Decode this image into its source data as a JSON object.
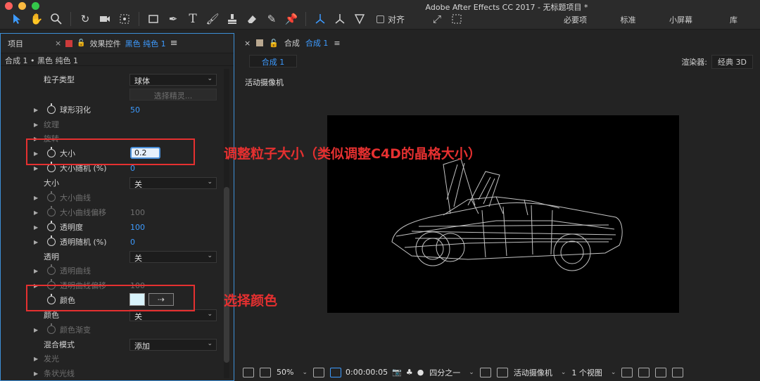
{
  "window": {
    "title": "Adobe After Effects CC 2017 - 无标题项目 *"
  },
  "toolbar": {
    "snap_label": "对齐"
  },
  "workspaces": [
    "必要项",
    "标准",
    "小屏幕",
    "库"
  ],
  "left_panel": {
    "tab_project": "项目",
    "tab_effects": "效果控件",
    "tab_effects_layer": "黑色 纯色 1",
    "breadcrumb": "合成 1 • 黑色 纯色 1",
    "rows": {
      "particle_type_label": "粒子类型",
      "particle_type_value": "球体",
      "choose_sprite": "选择精灵...",
      "sphere_feather_label": "球形羽化",
      "sphere_feather_value": "50",
      "texture_label": "纹理",
      "rotation_label": "旋转",
      "size_label": "大小",
      "size_value": "0.2",
      "size_random_label": "大小随机 (%)",
      "size_random_value": "0",
      "size_over_life_label": "大小",
      "size_over_life_value": "关",
      "size_curve_label": "大小曲线",
      "size_curve_offset_label": "大小曲线偏移",
      "size_curve_offset_value": "100",
      "opacity_label": "透明度",
      "opacity_value": "100",
      "opacity_random_label": "透明随机 (%)",
      "opacity_random_value": "0",
      "opacity_over_life_label": "透明",
      "opacity_over_life_value": "关",
      "opacity_curve_label": "透明曲线",
      "opacity_curve_offset_label": "透明曲线偏移",
      "opacity_curve_offset_value": "100",
      "color_label": "颜色",
      "color_value_hex": "#d8f3fb",
      "color_over_life_label": "颜色",
      "color_over_life_value": "关",
      "color_gradient_label": "颜色渐变",
      "blend_mode_label": "混合模式",
      "blend_mode_value": "添加",
      "glow_label": "发光",
      "streaklet_label": "条状光线"
    }
  },
  "right_panel": {
    "tab_label": "合成",
    "tab_comp_name": "合成 1",
    "subtab": "合成 1",
    "renderer_label": "渲染器:",
    "renderer_value": "经典 3D",
    "camera_label": "活动摄像机",
    "bottom": {
      "zoom": "50%",
      "timecode": "0:00:00:05",
      "resolution": "四分之一",
      "camera": "活动摄像机",
      "views": "1 个视图"
    }
  },
  "annotations": {
    "size_note": "调整粒子大小（类似调整C4D的晶格大小）",
    "color_note": "选择颜色"
  },
  "colors": {
    "accent": "#3d9bff",
    "annotation_red": "#e53030",
    "panel_bg": "#232323"
  }
}
